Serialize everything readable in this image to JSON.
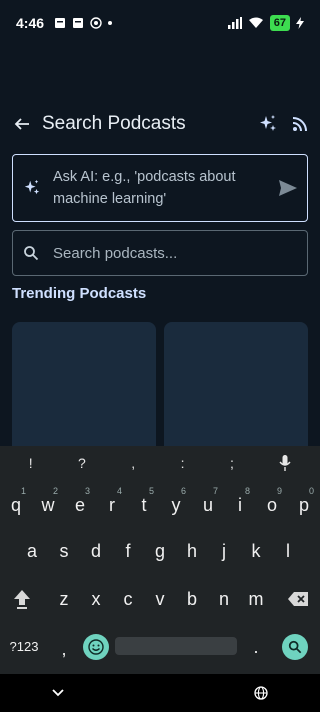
{
  "status_bar": {
    "time": "4:46",
    "battery": "67"
  },
  "header": {
    "title": "Search Podcasts"
  },
  "ai_search": {
    "placeholder": "Ask AI: e.g., 'podcasts about machine learning'"
  },
  "search": {
    "placeholder": "Search podcasts..."
  },
  "trending": {
    "title": "Trending Podcasts"
  },
  "keyboard": {
    "suggestions": [
      "!",
      "?",
      ",",
      ":",
      ";"
    ],
    "row1": [
      "q",
      "w",
      "e",
      "r",
      "t",
      "y",
      "u",
      "i",
      "o",
      "p"
    ],
    "row1_digits": [
      "1",
      "2",
      "3",
      "4",
      "5",
      "6",
      "7",
      "8",
      "9",
      "0"
    ],
    "row2": [
      "a",
      "s",
      "d",
      "f",
      "g",
      "h",
      "j",
      "k",
      "l"
    ],
    "row3": [
      "z",
      "x",
      "c",
      "v",
      "b",
      "n",
      "m"
    ],
    "symbols_key": "?123",
    "comma_key": ",",
    "period_key": "."
  },
  "colors": {
    "accent": "#cfe0ff",
    "background": "#0d1620",
    "card": "#1a2b3d",
    "teal": "#6fd3bf"
  }
}
